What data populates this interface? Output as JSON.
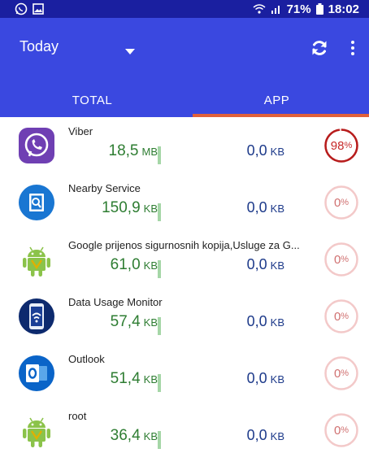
{
  "status_bar": {
    "battery": "71%",
    "time": "18:02"
  },
  "toolbar": {
    "period": "Today",
    "refresh_icon": "refresh-icon",
    "more_icon": "more-vert-icon"
  },
  "tabs": [
    {
      "label": "TOTAL",
      "selected": false
    },
    {
      "label": "APP",
      "selected": true
    }
  ],
  "apps": [
    {
      "name": "Viber",
      "rx_value": "18,5",
      "rx_unit": "MB",
      "tx_value": "0,0",
      "tx_unit": "KB",
      "percent": "98",
      "percent_unit": "%",
      "icon": "viber-icon"
    },
    {
      "name": "Nearby Service",
      "rx_value": "150,9",
      "rx_unit": "KB",
      "tx_value": "0,0",
      "tx_unit": "KB",
      "percent": "0",
      "percent_unit": "%",
      "icon": "nearby-service-icon"
    },
    {
      "name": "Google prijenos sigurnosnih kopija,Usluge za G...",
      "rx_value": "61,0",
      "rx_unit": "KB",
      "tx_value": "0,0",
      "tx_unit": "KB",
      "percent": "0",
      "percent_unit": "%",
      "icon": "android-icon"
    },
    {
      "name": "Data Usage Monitor",
      "rx_value": "57,4",
      "rx_unit": "KB",
      "tx_value": "0,0",
      "tx_unit": "KB",
      "percent": "0",
      "percent_unit": "%",
      "icon": "data-usage-monitor-icon"
    },
    {
      "name": "Outlook",
      "rx_value": "51,4",
      "rx_unit": "KB",
      "tx_value": "0,0",
      "tx_unit": "KB",
      "percent": "0",
      "percent_unit": "%",
      "icon": "outlook-icon"
    },
    {
      "name": "root",
      "rx_value": "36,4",
      "rx_unit": "KB",
      "tx_value": "0,0",
      "tx_unit": "KB",
      "percent": "0",
      "percent_unit": "%",
      "icon": "android-icon"
    }
  ],
  "colors": {
    "status_bar": "#1a1fa0",
    "app_bar": "#3a48e0",
    "tab_indicator": "#e0603a",
    "rx_text": "#2e7d32",
    "tx_text": "#1d3a8a",
    "ring_high": "#b71c1c",
    "ring_low": "#f3c9c9"
  }
}
